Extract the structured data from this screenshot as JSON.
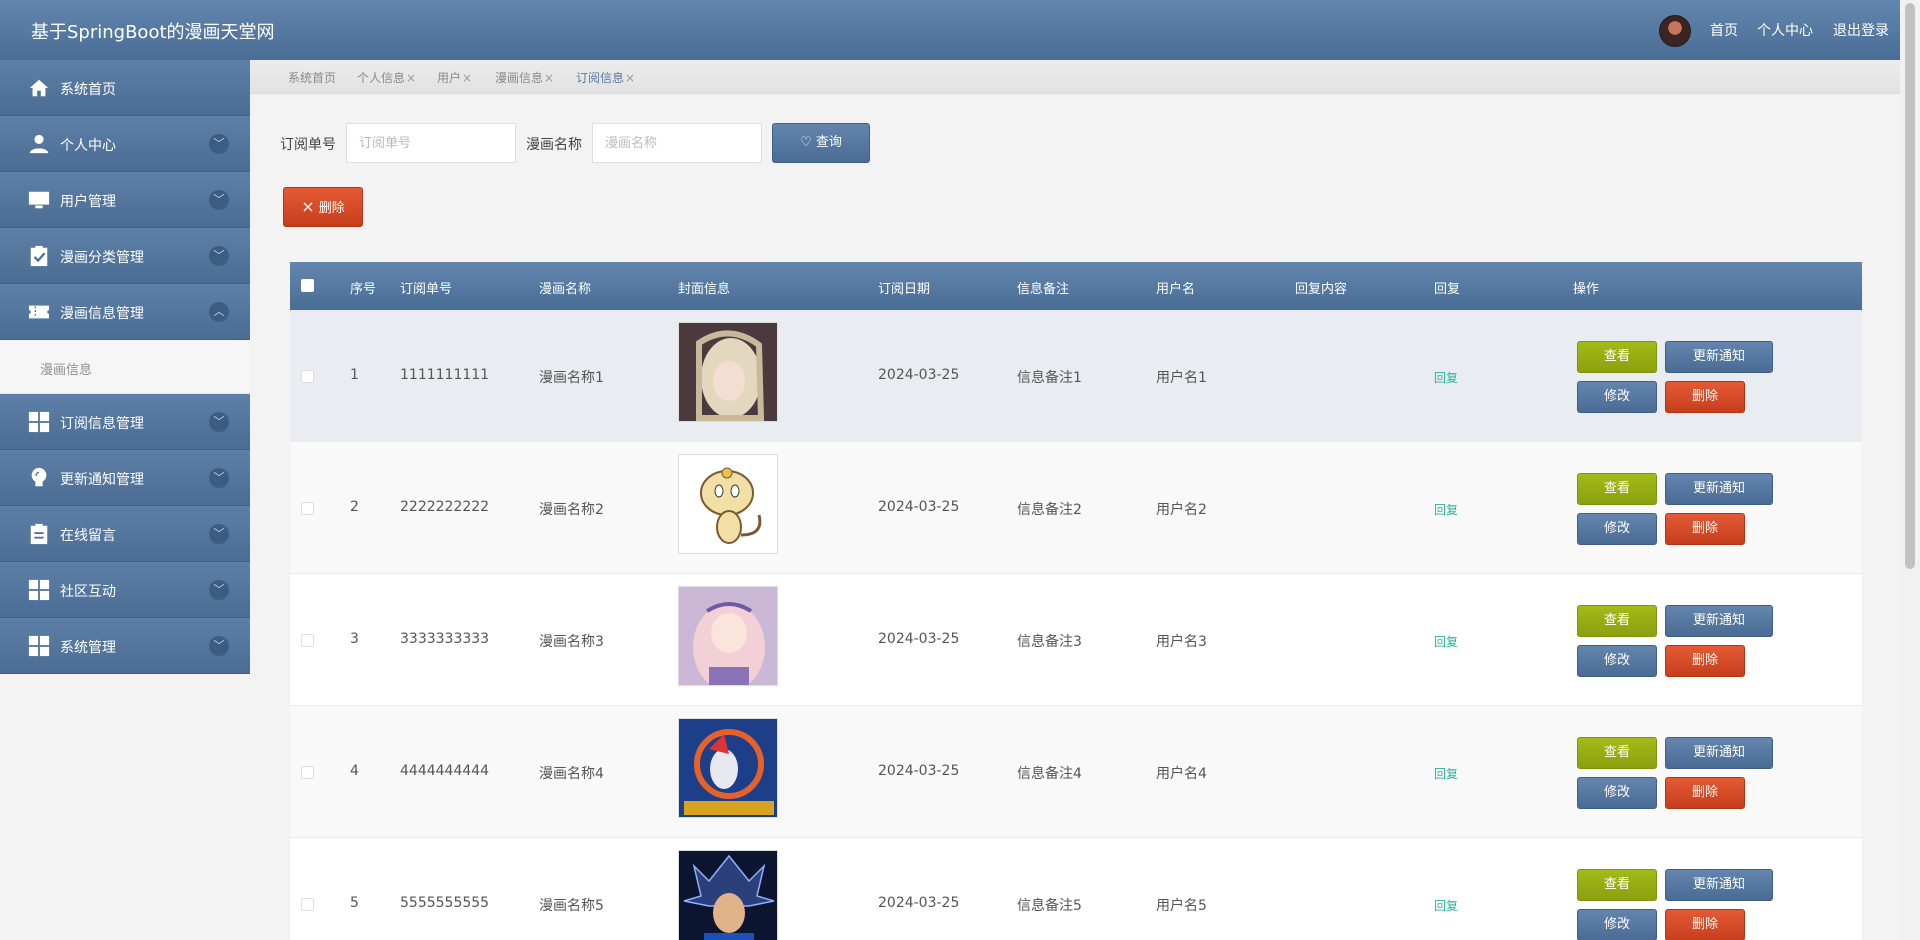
{
  "header": {
    "title": "基于SpringBoot的漫画天堂网",
    "nav": [
      "首页",
      "个人中心",
      "退出登录"
    ]
  },
  "sidebar": {
    "items": [
      {
        "label": "系统首页",
        "icon": "home-icon",
        "arrow": ""
      },
      {
        "label": "个人中心",
        "icon": "user-icon",
        "arrow": "﹀"
      },
      {
        "label": "用户管理",
        "icon": "monitor-icon",
        "arrow": "﹀"
      },
      {
        "label": "漫画分类管理",
        "icon": "clipboard-check-icon",
        "arrow": "﹀"
      },
      {
        "label": "漫画信息管理",
        "icon": "ticket-icon",
        "arrow": "︿"
      },
      {
        "label": "订阅信息管理",
        "icon": "grid-icon",
        "arrow": "﹀"
      },
      {
        "label": "更新通知管理",
        "icon": "bulb-icon",
        "arrow": "﹀"
      },
      {
        "label": "在线留言",
        "icon": "clipboard-icon",
        "arrow": "﹀"
      },
      {
        "label": "社区互动",
        "icon": "grid-icon",
        "arrow": "﹀"
      },
      {
        "label": "系统管理",
        "icon": "grid-icon",
        "arrow": "﹀"
      }
    ],
    "subitem": "漫画信息"
  },
  "tabs": [
    {
      "label": "系统首页",
      "closable": false
    },
    {
      "label": "个人信息",
      "closable": true
    },
    {
      "label": "用户",
      "closable": true
    },
    {
      "label": "漫画信息",
      "closable": true
    },
    {
      "label": "订阅信息",
      "closable": true
    }
  ],
  "close_glyph": "×",
  "search": {
    "order_label": "订阅单号",
    "order_placeholder": "订阅单号",
    "name_label": "漫画名称",
    "name_placeholder": "漫画名称",
    "query_button": "查询",
    "delete_button": "删除"
  },
  "table": {
    "columns": [
      "序号",
      "订阅单号",
      "漫画名称",
      "封面信息",
      "订阅日期",
      "信息备注",
      "用户名",
      "回复内容",
      "回复",
      "操作"
    ],
    "rows": [
      {
        "index": "1",
        "order_no": "1111111111",
        "name": "漫画名称1",
        "date": "2024-03-25",
        "note": "信息备注1",
        "user": "用户名1",
        "reply_content": "",
        "reply": "回复"
      },
      {
        "index": "2",
        "order_no": "2222222222",
        "name": "漫画名称2",
        "date": "2024-03-25",
        "note": "信息备注2",
        "user": "用户名2",
        "reply_content": "",
        "reply": "回复"
      },
      {
        "index": "3",
        "order_no": "3333333333",
        "name": "漫画名称3",
        "date": "2024-03-25",
        "note": "信息备注3",
        "user": "用户名3",
        "reply_content": "",
        "reply": "回复"
      },
      {
        "index": "4",
        "order_no": "4444444444",
        "name": "漫画名称4",
        "date": "2024-03-25",
        "note": "信息备注4",
        "user": "用户名4",
        "reply_content": "",
        "reply": "回复"
      },
      {
        "index": "5",
        "order_no": "5555555555",
        "name": "漫画名称5",
        "date": "2024-03-25",
        "note": "信息备注5",
        "user": "用户名5",
        "reply_content": "",
        "reply": "回复"
      }
    ],
    "actions": {
      "view": "查看",
      "notify": "更新通知",
      "edit": "修改",
      "delete": "删除"
    }
  },
  "colors": {
    "primary": "#5577a0",
    "danger": "#d34a28",
    "success": "#99b012",
    "reply": "#2bb398"
  }
}
